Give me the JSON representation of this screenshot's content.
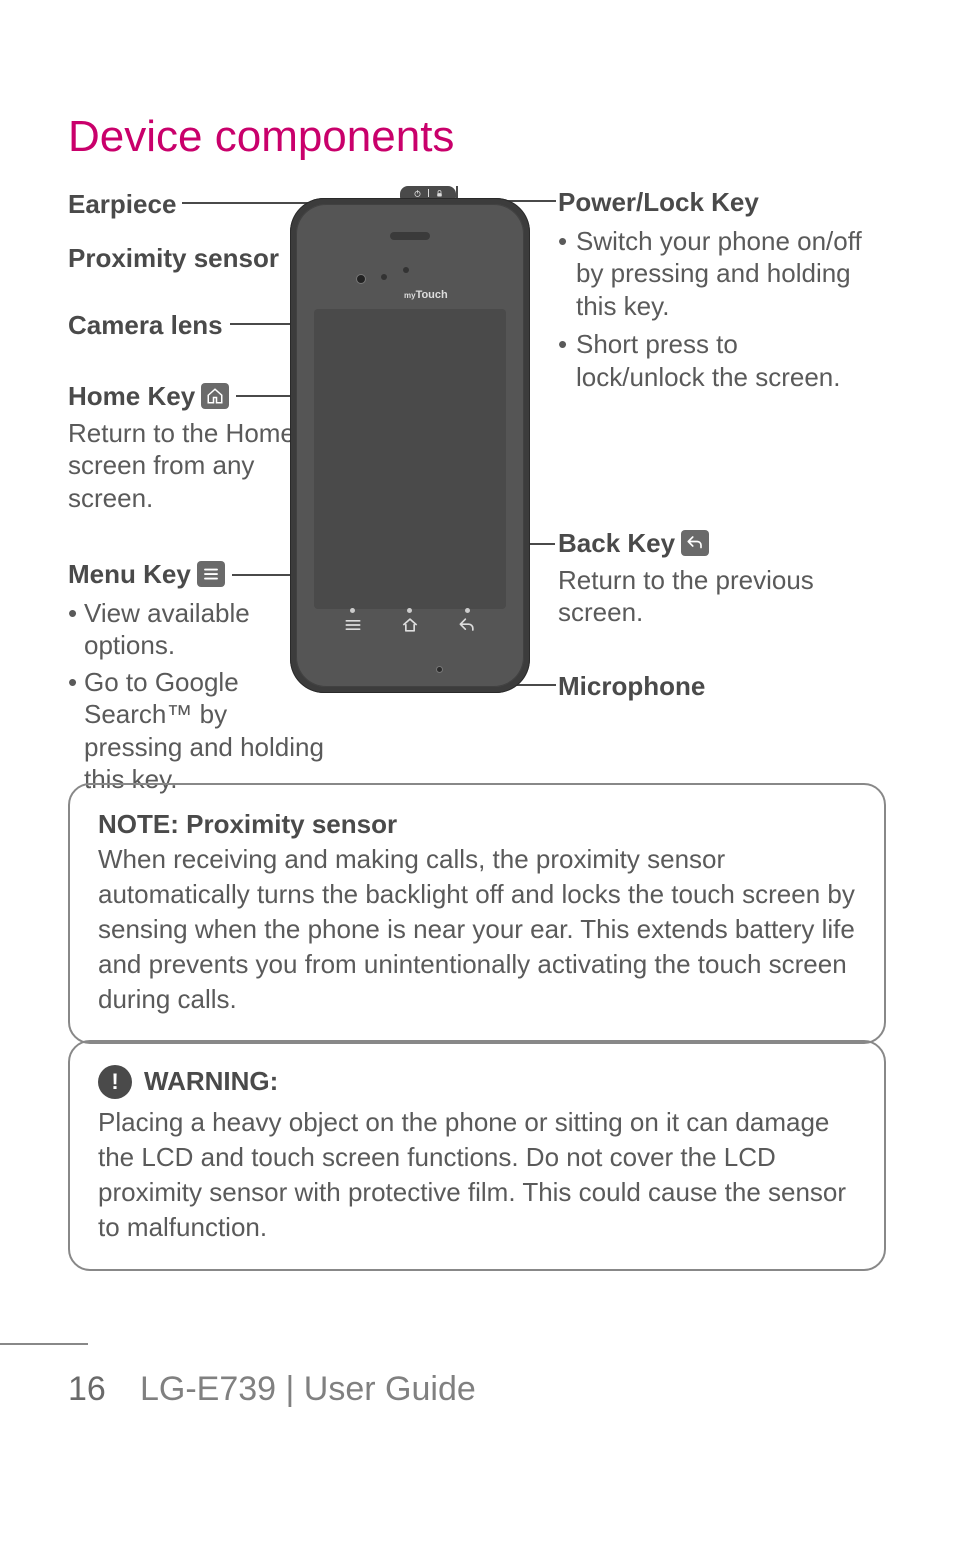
{
  "title": "Device components",
  "left": {
    "earpiece": "Earpiece",
    "proximity": "Proximity sensor",
    "camera": "Camera lens",
    "home": {
      "head": "Home Key",
      "body": "Return to the Home screen from any screen."
    },
    "menu": {
      "head": "Menu Key",
      "items": [
        "View available options.",
        "Go to Google Search™ by pressing and holding this key."
      ]
    }
  },
  "right": {
    "power": {
      "head": "Power/Lock Key",
      "items": [
        "Switch your phone on/off by pressing and holding this key.",
        "Short press to lock/unlock the screen."
      ]
    },
    "back": {
      "head": "Back Key",
      "body": "Return to the previous screen."
    },
    "mic": "Microphone"
  },
  "phone": {
    "brand": "myTouch"
  },
  "note": {
    "title": "NOTE: Proximity sensor",
    "body": "When receiving and making calls, the proximity sensor automatically turns the backlight off and locks the touch screen by sensing when the phone is near your ear. This extends battery life and prevents you from unintentionally activating the touch screen during calls."
  },
  "warning": {
    "title": "WARNING:",
    "body": "Placing a heavy object on the phone or sitting on it can damage the LCD and touch screen functions. Do not cover the LCD proximity sensor with protective film. This could cause the sensor to malfunction."
  },
  "footer": {
    "page": "16",
    "guide": "LG-E739  |  User Guide"
  }
}
